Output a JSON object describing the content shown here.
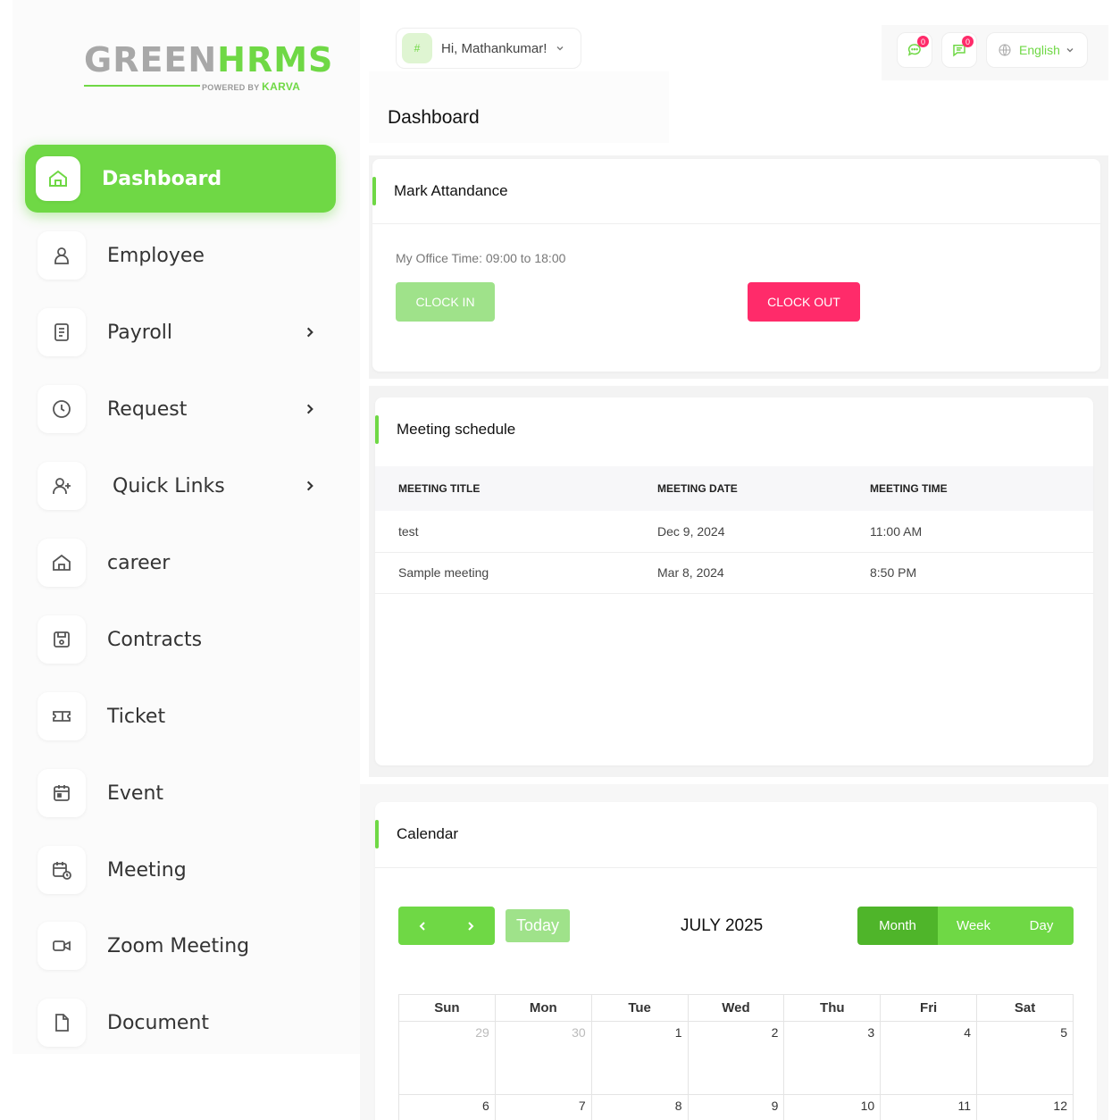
{
  "brand": {
    "logo_green": "GREEN",
    "logo_hrms": "HRMS",
    "powered_by": "POWERED BY",
    "powered_brand": "KARVA"
  },
  "sidebar": {
    "items": [
      {
        "label": "Dashboard",
        "icon": "home-icon"
      },
      {
        "label": "Employee",
        "icon": "user-icon"
      },
      {
        "label": "Payroll",
        "icon": "receipt-icon"
      },
      {
        "label": "Request",
        "icon": "clock-icon"
      },
      {
        "label": "Quick Links",
        "icon": "user-plus-icon"
      },
      {
        "label": "career",
        "icon": "home-icon"
      },
      {
        "label": "Contracts",
        "icon": "save-icon"
      },
      {
        "label": "Ticket",
        "icon": "ticket-icon"
      },
      {
        "label": "Event",
        "icon": "calendar-icon"
      },
      {
        "label": "Meeting",
        "icon": "calendar-clock-icon"
      },
      {
        "label": "Zoom Meeting",
        "icon": "video-icon"
      },
      {
        "label": "Document",
        "icon": "file-icon"
      }
    ]
  },
  "header": {
    "avatar_alt": "#",
    "greeting": "Hi, Mathankumar!",
    "page_title": "Dashboard",
    "chat_count": "0",
    "message_count": "0",
    "language": "English"
  },
  "attendance": {
    "title": "Mark Attandance",
    "office_time": "My Office Time: 09:00 to 18:00",
    "clock_in": "CLOCK IN",
    "clock_out": "CLOCK OUT"
  },
  "meetings": {
    "title": "Meeting schedule",
    "columns": [
      "MEETING TITLE",
      "MEETING DATE",
      "MEETING TIME"
    ],
    "rows": [
      [
        "test",
        "Dec 9, 2024",
        "11:00 AM"
      ],
      [
        "Sample meeting",
        "Mar 8, 2024",
        "8:50 PM"
      ]
    ]
  },
  "calendar": {
    "title": "Calendar",
    "today": "Today",
    "month_label": "JULY 2025",
    "views": [
      "Month",
      "Week",
      "Day"
    ],
    "weekdays": [
      "Sun",
      "Mon",
      "Tue",
      "Wed",
      "Thu",
      "Fri",
      "Sat"
    ],
    "weeks": [
      [
        "29",
        "30",
        "1",
        "2",
        "3",
        "4",
        "5"
      ],
      [
        "6",
        "7",
        "8",
        "9",
        "10",
        "11",
        "12"
      ]
    ]
  },
  "colors": {
    "accent": "#6fd845",
    "accent_light": "#9fe28a",
    "danger": "#ff2b6a"
  }
}
